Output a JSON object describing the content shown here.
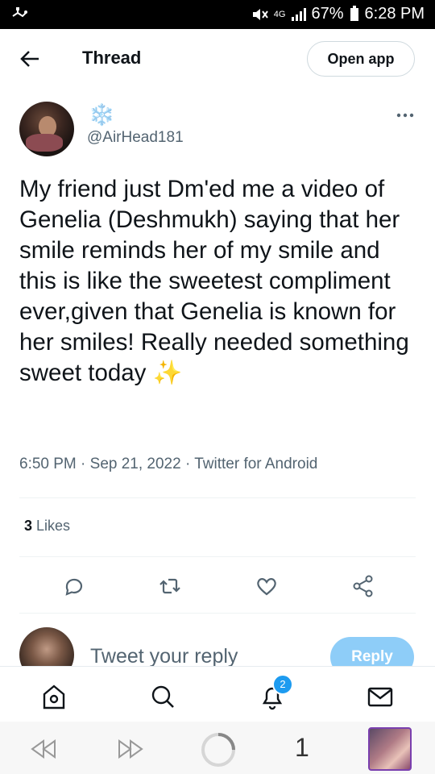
{
  "status_bar": {
    "network": "4G",
    "battery": "67%",
    "time": "6:28 PM"
  },
  "header": {
    "title": "Thread",
    "open_app": "Open app"
  },
  "tweet": {
    "display_name": "❄️",
    "handle": "@AirHead181",
    "text": "My friend just Dm'ed me a video of Genelia (Deshmukh) saying that her smile reminds her of my smile and this is like the sweetest compliment ever,given that Genelia is known for her smiles! Really needed something sweet today ✨",
    "meta": "6:50 PM · Sep 21, 2022 · Twitter for Android",
    "likes_count": "3",
    "likes_label": "Likes"
  },
  "actions": [
    "reply-icon",
    "retweet-icon",
    "like-icon",
    "share-icon"
  ],
  "reply": {
    "placeholder": "Tweet your reply",
    "button": "Reply"
  },
  "bottom_nav": {
    "items": [
      "home-icon",
      "search-icon",
      "notifications-icon",
      "messages-icon"
    ],
    "notification_badge": "2"
  },
  "browser": {
    "tab_count": "1"
  },
  "colors": {
    "accent": "#1d9bf0",
    "reply_button": "#8ecdf8",
    "secondary_text": "#536471"
  }
}
